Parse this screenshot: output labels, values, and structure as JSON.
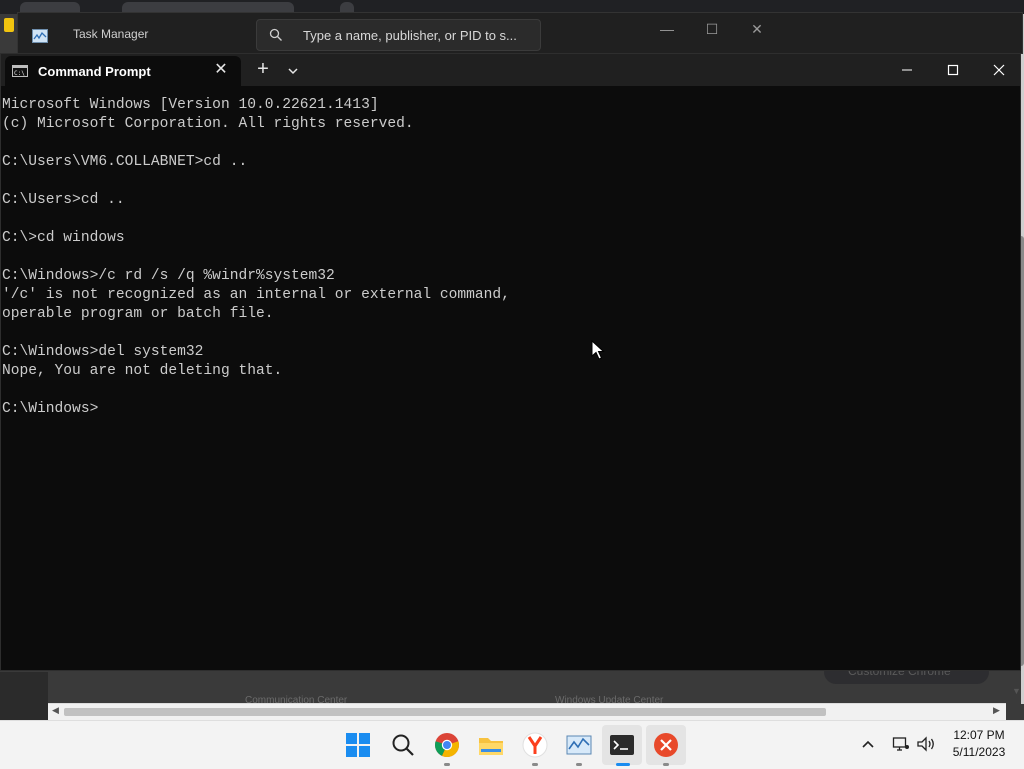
{
  "taskmanager": {
    "title": "Task Manager",
    "search_placeholder": "Type a name, publisher, or PID to s..."
  },
  "chrome": {
    "customize_label": "Customize Chrome",
    "bottom_text_left": "Communication Center",
    "bottom_text_right": "Windows Update Center"
  },
  "cmd": {
    "tab_title": "Command Prompt",
    "new_tab_label": "+",
    "close_tab_label": "✕",
    "lines": [
      "Microsoft Windows [Version 10.0.22621.1413]",
      "(c) Microsoft Corporation. All rights reserved.",
      "",
      "C:\\Users\\VM6.COLLABNET>cd ..",
      "",
      "C:\\Users>cd ..",
      "",
      "C:\\>cd windows",
      "",
      "C:\\Windows>/c rd /s /q %windr%system32",
      "'/c' is not recognized as an internal or external command,",
      "operable program or batch file.",
      "",
      "C:\\Windows>del system32",
      "Nope, You are not deleting that.",
      "",
      "C:\\Windows>"
    ]
  },
  "taskbar": {
    "time": "12:07 PM",
    "date": "5/11/2023",
    "icons": [
      "windows-start-icon",
      "search-icon",
      "chrome-icon",
      "file-explorer-icon",
      "yandex-icon",
      "task-manager-icon",
      "terminal-icon",
      "close-app-icon"
    ]
  },
  "colors": {
    "console_bg": "#0c0c0c",
    "console_text": "#cccccc",
    "titlebar_bg": "#202020",
    "taskbar_bg": "#f3f3f3",
    "accent_red": "#e8492a"
  }
}
